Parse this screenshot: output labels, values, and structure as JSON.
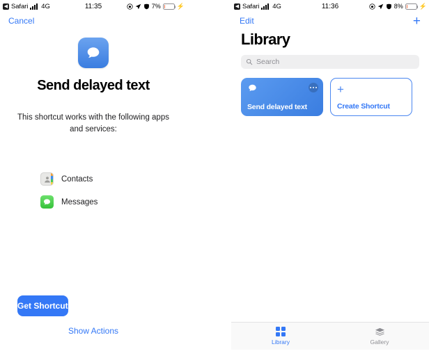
{
  "left": {
    "status": {
      "back_icon": "back-chevron-icon",
      "app": "Safari",
      "signal_icon": "signal-bars-icon",
      "network": "4G",
      "time": "11:35",
      "lock_icon": "rotation-lock-icon",
      "location_icon": "location-arrow-icon",
      "alarm_icon": "alarm-icon",
      "battery_percent": "7%",
      "battery_icon": "battery-icon",
      "charging_icon": "lightning-bolt-icon"
    },
    "nav": {
      "cancel_label": "Cancel"
    },
    "hero": {
      "app_icon": "message-bubble-icon",
      "title": "Send delayed text",
      "description": "This shortcut works with the following apps and services:"
    },
    "apps": [
      {
        "name": "Contacts",
        "icon": "contacts-app-icon"
      },
      {
        "name": "Messages",
        "icon": "messages-app-icon"
      }
    ],
    "actions": {
      "primary_label": "Get Shortcut",
      "secondary_label": "Show Actions"
    }
  },
  "right": {
    "status": {
      "back_icon": "back-chevron-icon",
      "app": "Safari",
      "signal_icon": "signal-bars-icon",
      "network": "4G",
      "time": "11:36",
      "lock_icon": "rotation-lock-icon",
      "location_icon": "location-arrow-icon",
      "alarm_icon": "alarm-icon",
      "battery_percent": "8%",
      "battery_icon": "battery-icon",
      "charging_icon": "lightning-bolt-icon"
    },
    "nav": {
      "edit_label": "Edit",
      "add_label": "+"
    },
    "title": "Library",
    "search": {
      "placeholder": "Search",
      "icon": "search-icon"
    },
    "cards": [
      {
        "title": "Send delayed text",
        "icon": "message-bubble-icon",
        "menu_icon": "more-dots-icon"
      },
      {
        "title": "Create Shortcut",
        "icon": "plus-icon"
      }
    ],
    "tabs": [
      {
        "label": "Library",
        "icon": "grid-squares-icon",
        "active": true
      },
      {
        "label": "Gallery",
        "icon": "layers-stack-icon",
        "active": false
      }
    ]
  },
  "colors": {
    "accent": "#3478f6",
    "messages_green": "#36c13a",
    "battery_low": "#f0724a",
    "muted": "#8e8e93"
  }
}
